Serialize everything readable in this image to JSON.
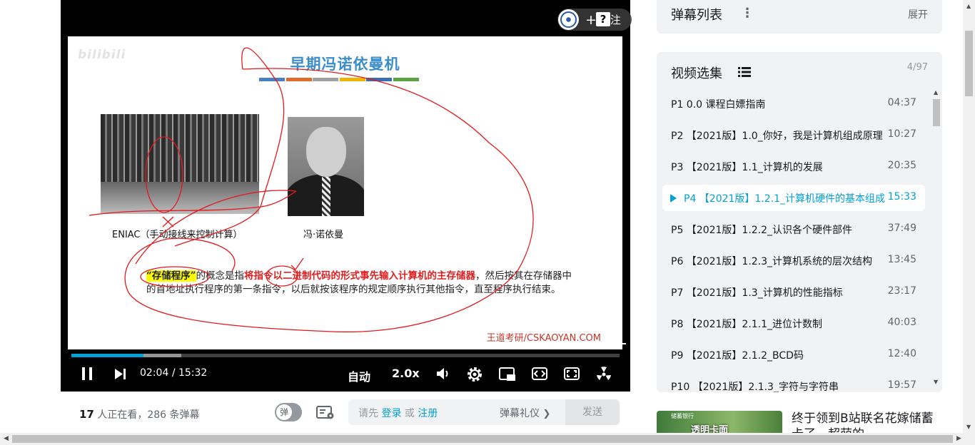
{
  "player": {
    "follow_label": "关注",
    "help_label": "?",
    "slide": {
      "watermark": "bilibili",
      "title": "早期冯诺依曼机",
      "bar_colors": [
        "#4a7fc1",
        "#e46c2a",
        "#a0a0a0",
        "#f0b400",
        "#3a6db3",
        "#5aa342"
      ],
      "eniac_caption": "ENIAC（手动接线来控制计算）",
      "neumann_caption": "冯·诺依曼",
      "body_highlight": "“存储程序”",
      "body_mid": "的概念是指",
      "body_red": "将指令以二进制代码的形式事先输入计算机的主存储器",
      "body_rest": "，然后按其在存储器中的首地址执行程序的第一条指令，以后就按该程序的规定顺序执行其他指令，直至程序执行结束。",
      "brand": "王道考研/CSKAOYAN.COM"
    },
    "progress": {
      "played_fraction": 0.132,
      "buffered_fraction": 0.2
    },
    "controls": {
      "current_time": "02:04",
      "separator": "/",
      "total_time": "15:32",
      "quality_label": "自动",
      "speed_label": "2.0x"
    }
  },
  "info_bar": {
    "viewers_count": "17",
    "viewers_text": " 人正在看，",
    "danmaku_count": "286",
    "danmaku_text": " 条弹幕",
    "toggle_label": "弹",
    "input_prefix": "请先 ",
    "login_label": "登录",
    "or_label": " 或 ",
    "register_label": "注册",
    "etiquette_label": "弹幕礼仪",
    "send_label": "发送"
  },
  "sidebar": {
    "danmaku_list_title": "弹幕列表",
    "expand_label": "展开",
    "episodes_title": "视频选集",
    "episodes_count": "4/97",
    "episodes": [
      {
        "label": "P1   0.0 课程白嫖指南",
        "duration": "04:37"
      },
      {
        "label": "P2   【2021版】1.0_你好，我是计算机组成原理",
        "duration": "10:27"
      },
      {
        "label": "P3   【2021版】1.1_计算机的发展",
        "duration": "20:35"
      },
      {
        "label": "P4   【2021版】1.2.1_计算机硬件的基本组成",
        "duration": "15:33",
        "active": true
      },
      {
        "label": "P5   【2021版】1.2.2_认识各个硬件部件",
        "duration": "37:49"
      },
      {
        "label": "P6   【2021版】1.2.3_计算机系统的层次结构",
        "duration": "13:45"
      },
      {
        "label": "P7   【2021版】1.3_计算机的性能指标",
        "duration": "23:17"
      },
      {
        "label": "P8   【2021版】2.1.1_进位计数制",
        "duration": "40:03"
      },
      {
        "label": "P9   【2021版】2.1.2_BCD码",
        "duration": "12:40"
      },
      {
        "label": "P10   【2021版】2.1.3_字符与字符串",
        "duration": "19:57"
      }
    ],
    "recommend": {
      "thumb_text": "透明卡面",
      "thumb_tag": "储蓄银行",
      "title": "终于领到B站联名花嫁储蓄卡了，超萌的"
    }
  }
}
